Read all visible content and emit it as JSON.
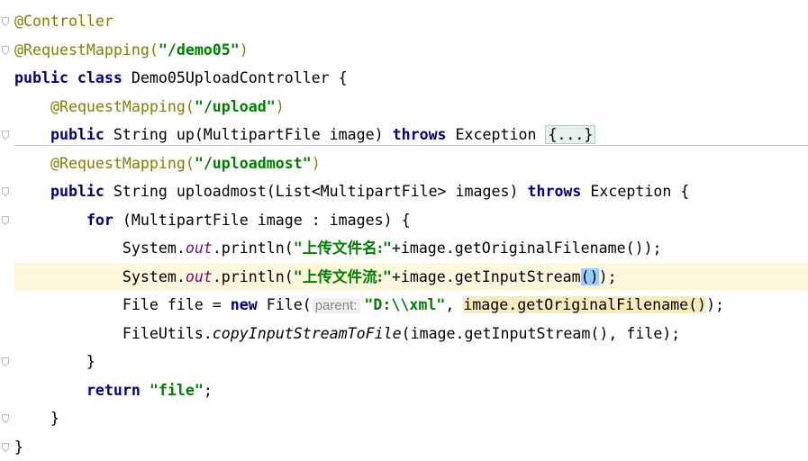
{
  "editor": {
    "lines": [
      {
        "parts": [
          {
            "t": "@Controller",
            "c": "ann"
          }
        ]
      },
      {
        "parts": [
          {
            "t": "@RequestMapping(",
            "c": "ann"
          },
          {
            "t": "\"/demo05\"",
            "c": "str"
          },
          {
            "t": ")",
            "c": "ann"
          }
        ]
      },
      {
        "parts": [
          {
            "t": "public class ",
            "c": "kw"
          },
          {
            "t": "Demo05UploadController {",
            "c": ""
          }
        ]
      },
      {
        "parts": [
          {
            "t": "    ",
            "c": ""
          },
          {
            "t": "@RequestMapping(",
            "c": "ann"
          },
          {
            "t": "\"/upload\"",
            "c": "str"
          },
          {
            "t": ")",
            "c": "ann"
          }
        ]
      },
      {
        "parts": [
          {
            "t": "    ",
            "c": ""
          },
          {
            "t": "public ",
            "c": "kw"
          },
          {
            "t": "String up(MultipartFile image) ",
            "c": ""
          },
          {
            "t": "throws ",
            "c": "kw"
          },
          {
            "t": "Exception ",
            "c": ""
          },
          {
            "t": "{...}",
            "c": "folded"
          }
        ]
      },
      {
        "parts": [
          {
            "t": "    ",
            "c": ""
          },
          {
            "t": "@RequestMapping(",
            "c": "ann"
          },
          {
            "t": "\"/uploadmost\"",
            "c": "str"
          },
          {
            "t": ")",
            "c": "ann"
          }
        ]
      },
      {
        "parts": [
          {
            "t": "    ",
            "c": ""
          },
          {
            "t": "public ",
            "c": "kw"
          },
          {
            "t": "String uploadmost(List<MultipartFile> images) ",
            "c": ""
          },
          {
            "t": "throws ",
            "c": "kw"
          },
          {
            "t": "Exception {",
            "c": ""
          }
        ]
      },
      {
        "parts": [
          {
            "t": "        ",
            "c": ""
          },
          {
            "t": "for ",
            "c": "kw"
          },
          {
            "t": "(MultipartFile image : images) {",
            "c": ""
          }
        ]
      },
      {
        "parts": [
          {
            "t": "            System.",
            "c": ""
          },
          {
            "t": "out",
            "c": "static"
          },
          {
            "t": ".println(",
            "c": ""
          },
          {
            "t": "\"",
            "c": "str"
          },
          {
            "t": "上传文件名:",
            "c": "str cjk"
          },
          {
            "t": "\"",
            "c": "str"
          },
          {
            "t": "+image.getOriginalFilename());",
            "c": ""
          }
        ]
      },
      {
        "highlight": true,
        "parts": [
          {
            "t": "            System.",
            "c": ""
          },
          {
            "t": "out",
            "c": "static"
          },
          {
            "t": ".println(",
            "c": ""
          },
          {
            "t": "\"",
            "c": "str"
          },
          {
            "t": "上传文件流:",
            "c": "str cjk"
          },
          {
            "t": "\"",
            "c": "str"
          },
          {
            "t": "+image.getInputStream",
            "c": ""
          },
          {
            "t": "()",
            "c": "paren-hl"
          },
          {
            "t": ");",
            "c": ""
          }
        ]
      },
      {
        "parts": [
          {
            "t": "            File file = ",
            "c": ""
          },
          {
            "t": "new ",
            "c": "kw"
          },
          {
            "t": "File(",
            "c": ""
          },
          {
            "t": "parent:",
            "c": "hint"
          },
          {
            "t": "\"D:\\\\xml\"",
            "c": "str"
          },
          {
            "t": ", ",
            "c": ""
          },
          {
            "t": "image.getOriginalFilename()",
            "c": "arg-hl"
          },
          {
            "t": ");",
            "c": ""
          }
        ]
      },
      {
        "parts": [
          {
            "t": "            FileUtils.",
            "c": ""
          },
          {
            "t": "copyInputStreamToFile",
            "c": "staticm"
          },
          {
            "t": "(image.getInputStream(), file);",
            "c": ""
          }
        ]
      },
      {
        "parts": [
          {
            "t": "        }",
            "c": ""
          }
        ]
      },
      {
        "parts": [
          {
            "t": "        ",
            "c": ""
          },
          {
            "t": "return ",
            "c": "kw"
          },
          {
            "t": "\"file\"",
            "c": "str"
          },
          {
            "t": ";",
            "c": ""
          }
        ]
      },
      {
        "parts": [
          {
            "t": "    }",
            "c": ""
          }
        ]
      },
      {
        "parts": [
          {
            "t": "}",
            "c": ""
          }
        ]
      }
    ]
  }
}
